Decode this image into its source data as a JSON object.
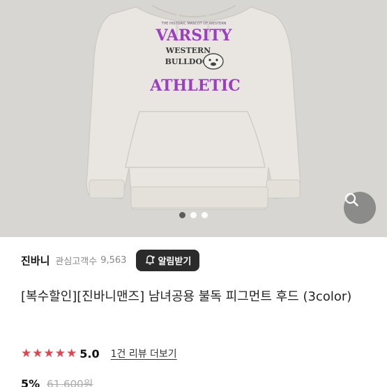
{
  "product_image": {
    "print_top_small": "THE HISTORIC MASCOT OF WESTERN",
    "print_varsity": "VARSITY",
    "print_western": "WESTERN",
    "print_bulldog": "BULLDOG",
    "print_athletic": "ATHLETIC",
    "print_color": "#9b3fc0",
    "background_color": "#d9d7d3",
    "garment_color": "#e8e5e0"
  },
  "carousel": {
    "page_count": 3,
    "active_index": 0
  },
  "search_icon": "search-icon",
  "seller": {
    "name": "진바니",
    "fans_label": "관심고객수",
    "fans_count": "9,563",
    "alarm_label": "알림받기",
    "alarm_icon": "bell-plus-icon"
  },
  "product": {
    "title": "[복수할인][진바니맨즈] 남녀공용 불독 피그먼트 후드 (3color)",
    "rating": "5.0",
    "star_color": "#e8414b",
    "review_link": "1건 리뷰 더보기",
    "discount": "5%",
    "original_price": "61,600원"
  }
}
